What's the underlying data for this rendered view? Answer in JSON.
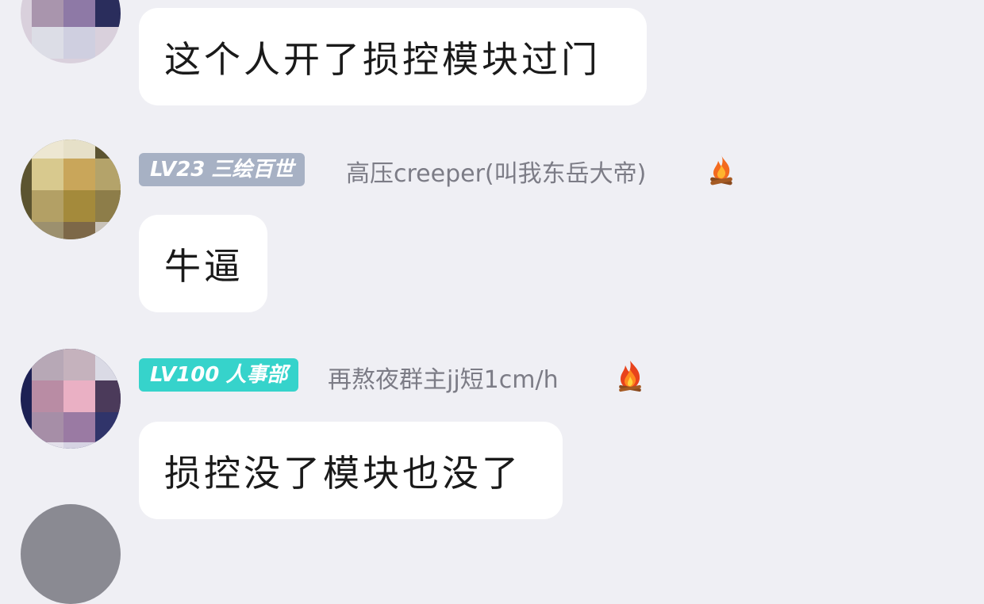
{
  "messages": [
    {
      "text": "这个人开了损控模块过门"
    },
    {
      "level": "LV23",
      "title": "三绘百世",
      "name": "高压creeper(叫我东岳大帝)",
      "badge_color": "#a7b1c4",
      "flame_icon": "campfire-icon",
      "text": "牛逼"
    },
    {
      "level": "LV100",
      "title": "人事部",
      "name": "再熬夜群主jj短1cm/h",
      "badge_color": "#36d3cb",
      "flame_icon": "fire-icon",
      "text": "损控没了模块也没了"
    }
  ]
}
